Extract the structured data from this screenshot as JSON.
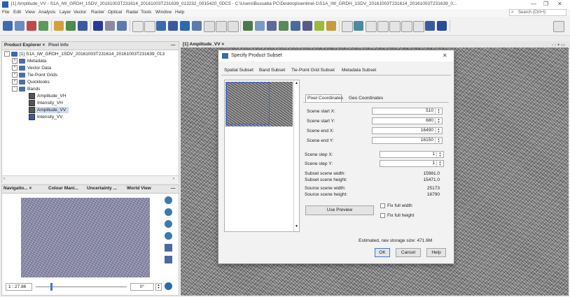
{
  "window": {
    "title": "[1] Amplitude_VV - S1A_IW_GRDH_1SDV_20161003T231614_20161003T231639_013232_0015420_0DC5 - C:\\Users\\Bussaba PC\\Desktop\\sentinel-1\\S1A_IW_GRDH_1SDV_20161003T231614_20161003T231639_0...",
    "minimize": "—",
    "maximize": "❐",
    "close": "✕"
  },
  "menu": [
    "File",
    "Edit",
    "View",
    "Analysis",
    "Layer",
    "Vector",
    "Raster",
    "Optical",
    "Radar",
    "Tools",
    "Window",
    "Help"
  ],
  "search": {
    "placeholder": "Search (Ctrl+I)"
  },
  "product_explorer": {
    "tabs": [
      "Product Explorer ×",
      "Pixel Info"
    ],
    "minimize": "—",
    "root": "[1] S1A_IW_GRDH_1SDV_20161003T231614_20161003T231639_013",
    "nodes": [
      "Metadata",
      "Vector Data",
      "Tie-Point Grids",
      "Quicklooks",
      "Bands"
    ],
    "bands": [
      "Amplitude_VH",
      "Intensity_VH",
      "Amplitude_VV",
      "Intensity_VV"
    ]
  },
  "image_view": {
    "tab": "[1] Amplitude_VV ×",
    "controls": "‹ › ▾ ▭"
  },
  "nav_panel": {
    "tabs": [
      "Navigatio... ×",
      "Colour Mani...",
      "Uncertainty ...",
      "World View"
    ],
    "minimize": "—",
    "scale": "1 : 27.86",
    "rotation": "0°"
  },
  "dialog": {
    "title": "Specify Product Subset",
    "close": "✕",
    "tabs": [
      "Spatial Subset",
      "Band Subset",
      "Tie-Point Grid Subset",
      "Metadata Subset"
    ],
    "subtabs": [
      "Pixel Coordinates",
      "Geo Coordinates"
    ],
    "fields": [
      {
        "label": "Scene start X:",
        "value": "510"
      },
      {
        "label": "Scene start Y:",
        "value": "680"
      },
      {
        "label": "Scene end X:",
        "value": "16490"
      },
      {
        "label": "Scene end Y:",
        "value": "16150"
      }
    ],
    "steps": [
      {
        "label": "Scene step X:",
        "value": "1"
      },
      {
        "label": "Scene step Y:",
        "value": "1"
      }
    ],
    "info": [
      {
        "label": "Subset scene width:",
        "value": "15981.0"
      },
      {
        "label": "Subset scene height:",
        "value": "15471.0"
      },
      {
        "label": "Source scene width:",
        "value": "25173"
      },
      {
        "label": "Source scene height:",
        "value": "16790"
      }
    ],
    "use_preview": "Use Preview",
    "fix_width": "Fix full width",
    "fix_height": "Fix full height",
    "storage": "Estimated, raw storage size: 471.6M",
    "ok": "OK",
    "cancel": "Cancel",
    "help": "Help"
  }
}
